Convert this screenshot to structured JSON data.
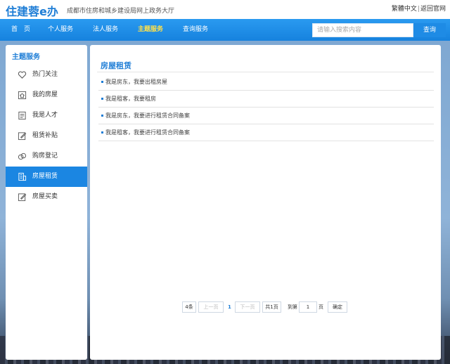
{
  "header": {
    "logo": "住建蓉e办",
    "subtitle": "成都市住房和城乡建设局网上政务大厅",
    "links": [
      "繁體中文",
      "返回官网"
    ]
  },
  "nav": {
    "items": [
      "首　页",
      "个人服务",
      "法人服务",
      "主题服务",
      "查询服务"
    ],
    "active_index": 3,
    "search_placeholder": "请输入搜索内容",
    "search_button": "查询"
  },
  "sidebar": {
    "title": "主题服务",
    "items": [
      {
        "label": "热门关注",
        "icon": "heart-icon"
      },
      {
        "label": "我的房屋",
        "icon": "house-icon"
      },
      {
        "label": "我是人才",
        "icon": "id-card-icon"
      },
      {
        "label": "租赁补贴",
        "icon": "edit-icon"
      },
      {
        "label": "购房登记",
        "icon": "coins-icon"
      },
      {
        "label": "房屋租赁",
        "icon": "building-icon"
      },
      {
        "label": "房屋买卖",
        "icon": "edit-icon"
      }
    ],
    "active_index": 5
  },
  "main": {
    "title": "房屋租赁",
    "items": [
      "我是房东，我要出租房屋",
      "我是租客，我要租房",
      "我是房东，我要进行租赁合同备案",
      "我是租客，我要进行租赁合同备案"
    ]
  },
  "pager": {
    "total": "4条",
    "prev": "上一页",
    "current": "1",
    "next": "下一页",
    "pages": "共1页",
    "goto_prefix": "到第",
    "goto_value": "1",
    "goto_suffix": "页",
    "confirm": "确定"
  },
  "colors": {
    "brand": "#1f7ed6",
    "nav_bg": "#1a8ae6",
    "active_nav": "#ffe14a"
  }
}
